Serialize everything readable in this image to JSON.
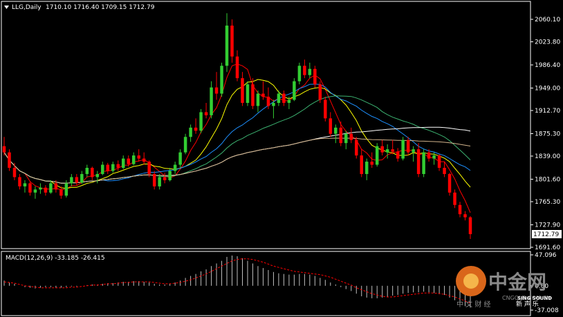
{
  "header": {
    "symbol": "LLG,Daily",
    "ohlc_text": "1710.10 1716.40 1709.15 1712.79"
  },
  "price_panel": {
    "last_price_label": "1712.79",
    "ticks": [
      2060.1,
      2023.8,
      1986.4,
      1949.0,
      1912.7,
      1875.3,
      1839.0,
      1801.6,
      1765.3,
      1727.9,
      1691.6
    ],
    "tick_labels": [
      "2060.10",
      "2023.80",
      "1986.40",
      "1949.00",
      "1912.70",
      "1875.30",
      "1839.00",
      "1801.60",
      "1765.30",
      "1727.90",
      "1691.60"
    ]
  },
  "macd_panel": {
    "label": "MACD(12,26,9) -33.185 -26.415",
    "tick_labels": [
      "47.096",
      "0.00",
      "-37.008"
    ]
  },
  "watermark": {
    "brand_cn": "中金网",
    "site": "CNGOLD.COM.CN",
    "sub_cn": "中 文 财 经",
    "sing": "SING SOUND",
    "sing_cn": "新 声 乐"
  },
  "colors": {
    "background": "#000000",
    "bull": "#32cd32",
    "bear": "#ff0000",
    "ma_yellow": "#ffff00",
    "ma_blue": "#1e90ff",
    "ma_green": "#3cb371",
    "ma_white": "#ffffff",
    "ma_tan": "#d2b48c",
    "ma_pink": "#ff69b4",
    "macd_hist": "#c0c0c0",
    "macd_signal": "#ff0000"
  },
  "chart_data": {
    "type": "candlestick",
    "title": "LLG,Daily",
    "ylim": [
      1691.6,
      2060.1
    ],
    "candles": [
      [
        1855,
        1870,
        1840,
        1845
      ],
      [
        1845,
        1850,
        1815,
        1820
      ],
      [
        1820,
        1828,
        1800,
        1805
      ],
      [
        1805,
        1810,
        1785,
        1790
      ],
      [
        1790,
        1800,
        1780,
        1795
      ],
      [
        1795,
        1798,
        1775,
        1780
      ],
      [
        1780,
        1790,
        1770,
        1785
      ],
      [
        1785,
        1795,
        1778,
        1788
      ],
      [
        1788,
        1792,
        1775,
        1780
      ],
      [
        1780,
        1800,
        1778,
        1795
      ],
      [
        1795,
        1800,
        1780,
        1785
      ],
      [
        1785,
        1790,
        1770,
        1775
      ],
      [
        1775,
        1800,
        1772,
        1795
      ],
      [
        1795,
        1810,
        1790,
        1805
      ],
      [
        1805,
        1810,
        1792,
        1796
      ],
      [
        1796,
        1815,
        1794,
        1810
      ],
      [
        1810,
        1825,
        1805,
        1820
      ],
      [
        1820,
        1822,
        1800,
        1805
      ],
      [
        1805,
        1815,
        1795,
        1810
      ],
      [
        1810,
        1830,
        1808,
        1825
      ],
      [
        1825,
        1828,
        1810,
        1815
      ],
      [
        1815,
        1830,
        1812,
        1826
      ],
      [
        1826,
        1832,
        1815,
        1820
      ],
      [
        1820,
        1840,
        1818,
        1835
      ],
      [
        1835,
        1840,
        1822,
        1826
      ],
      [
        1826,
        1845,
        1824,
        1840
      ],
      [
        1840,
        1850,
        1830,
        1835
      ],
      [
        1835,
        1845,
        1825,
        1830
      ],
      [
        1830,
        1832,
        1805,
        1810
      ],
      [
        1810,
        1815,
        1785,
        1790
      ],
      [
        1790,
        1810,
        1785,
        1805
      ],
      [
        1805,
        1812,
        1795,
        1800
      ],
      [
        1800,
        1820,
        1798,
        1815
      ],
      [
        1815,
        1830,
        1810,
        1825
      ],
      [
        1825,
        1850,
        1820,
        1845
      ],
      [
        1845,
        1875,
        1842,
        1870
      ],
      [
        1870,
        1890,
        1862,
        1885
      ],
      [
        1885,
        1900,
        1875,
        1880
      ],
      [
        1880,
        1915,
        1876,
        1910
      ],
      [
        1910,
        1925,
        1900,
        1905
      ],
      [
        1905,
        1960,
        1900,
        1950
      ],
      [
        1950,
        1975,
        1930,
        1940
      ],
      [
        1940,
        1990,
        1935,
        1985
      ],
      [
        1985,
        2070,
        1975,
        2050
      ],
      [
        2050,
        2060,
        1990,
        2000
      ],
      [
        2000,
        2010,
        1960,
        1965
      ],
      [
        1965,
        1975,
        1920,
        1925
      ],
      [
        1925,
        1960,
        1920,
        1955
      ],
      [
        1955,
        1965,
        1915,
        1920
      ],
      [
        1920,
        1945,
        1910,
        1940
      ],
      [
        1940,
        1960,
        1930,
        1935
      ],
      [
        1935,
        1950,
        1915,
        1920
      ],
      [
        1920,
        1930,
        1900,
        1925
      ],
      [
        1925,
        1945,
        1920,
        1940
      ],
      [
        1940,
        1945,
        1920,
        1925
      ],
      [
        1925,
        1935,
        1915,
        1930
      ],
      [
        1930,
        1965,
        1928,
        1960
      ],
      [
        1960,
        1990,
        1955,
        1985
      ],
      [
        1985,
        1995,
        1965,
        1970
      ],
      [
        1970,
        1990,
        1965,
        1980
      ],
      [
        1980,
        1985,
        1950,
        1955
      ],
      [
        1955,
        1960,
        1925,
        1930
      ],
      [
        1930,
        1935,
        1895,
        1900
      ],
      [
        1900,
        1910,
        1870,
        1875
      ],
      [
        1875,
        1890,
        1860,
        1885
      ],
      [
        1885,
        1895,
        1855,
        1860
      ],
      [
        1860,
        1880,
        1850,
        1875
      ],
      [
        1875,
        1885,
        1860,
        1865
      ],
      [
        1865,
        1870,
        1835,
        1840
      ],
      [
        1840,
        1850,
        1805,
        1810
      ],
      [
        1810,
        1835,
        1800,
        1830
      ],
      [
        1830,
        1845,
        1820,
        1825
      ],
      [
        1825,
        1860,
        1822,
        1855
      ],
      [
        1855,
        1865,
        1840,
        1845
      ],
      [
        1845,
        1858,
        1835,
        1850
      ],
      [
        1850,
        1865,
        1842,
        1846
      ],
      [
        1846,
        1852,
        1830,
        1835
      ],
      [
        1835,
        1870,
        1832,
        1865
      ],
      [
        1865,
        1870,
        1840,
        1845
      ],
      [
        1845,
        1855,
        1830,
        1850
      ],
      [
        1850,
        1860,
        1805,
        1810
      ],
      [
        1810,
        1850,
        1805,
        1845
      ],
      [
        1845,
        1850,
        1830,
        1835
      ],
      [
        1835,
        1845,
        1825,
        1840
      ],
      [
        1840,
        1842,
        1815,
        1820
      ],
      [
        1820,
        1830,
        1805,
        1810
      ],
      [
        1810,
        1812,
        1775,
        1780
      ],
      [
        1780,
        1785,
        1755,
        1760
      ],
      [
        1760,
        1765,
        1740,
        1745
      ],
      [
        1745,
        1750,
        1735,
        1740
      ],
      [
        1740,
        1742,
        1705,
        1712.79
      ]
    ],
    "macd_hist": [
      8,
      5,
      3,
      0,
      -2,
      -3,
      -4,
      -3,
      -2,
      -2,
      -3,
      -3,
      -2,
      -1,
      -1,
      0,
      1,
      2,
      2,
      3,
      4,
      4,
      5,
      6,
      6,
      7,
      7,
      6,
      5,
      3,
      2,
      2,
      3,
      5,
      8,
      12,
      15,
      18,
      22,
      25,
      30,
      34,
      38,
      44,
      46,
      45,
      42,
      38,
      34,
      30,
      27,
      24,
      21,
      19,
      18,
      17,
      17,
      18,
      18,
      17,
      15,
      12,
      9,
      5,
      2,
      -2,
      -5,
      -8,
      -12,
      -16,
      -18,
      -19,
      -19,
      -18,
      -17,
      -15,
      -14,
      -12,
      -11,
      -10,
      -10,
      -9,
      -10,
      -11,
      -12,
      -14,
      -18,
      -22,
      -27,
      -31,
      -33.185
    ],
    "macd_signal": [
      6,
      5,
      4,
      2,
      0,
      -1,
      -2,
      -3,
      -3,
      -3,
      -3,
      -3,
      -3,
      -2,
      -2,
      -1,
      0,
      1,
      1,
      2,
      3,
      3,
      4,
      5,
      5,
      6,
      6,
      6,
      6,
      5,
      4,
      3,
      3,
      4,
      5,
      7,
      9,
      12,
      15,
      18,
      22,
      26,
      30,
      34,
      38,
      40,
      41,
      41,
      40,
      38,
      36,
      33,
      30,
      28,
      26,
      24,
      22,
      21,
      20,
      19,
      18,
      17,
      15,
      13,
      10,
      7,
      4,
      1,
      -3,
      -6,
      -9,
      -12,
      -14,
      -16,
      -17,
      -17,
      -16,
      -15,
      -14,
      -13,
      -12,
      -11,
      -11,
      -11,
      -12,
      -13,
      -15,
      -17,
      -20,
      -23,
      -26.415
    ],
    "macd_ylim": [
      -37.008,
      47.096
    ]
  }
}
